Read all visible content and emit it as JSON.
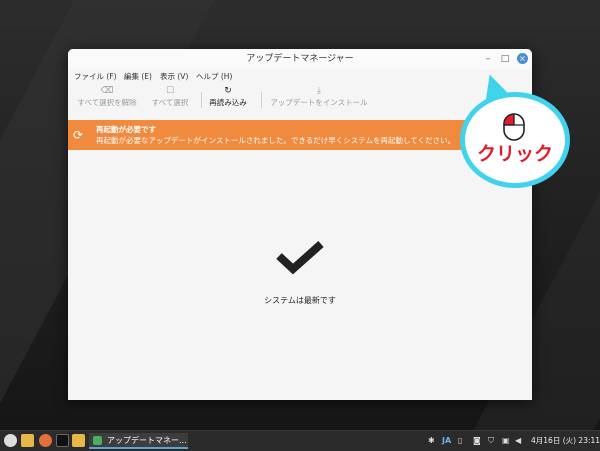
{
  "window": {
    "title": "アップデートマネージャー",
    "controls": {
      "minimize": "–",
      "maximize": "□",
      "close": "×"
    }
  },
  "menu": [
    "ファイル (F)",
    "編集 (E)",
    "表示 (V)",
    "ヘルプ (H)"
  ],
  "toolbar": {
    "clear_label": "すべて選択を解除",
    "clear_icon": "⌫",
    "select_all_label": "すべて選択",
    "select_all_icon": "☐",
    "refresh_label": "再読み込み",
    "refresh_icon": "↻",
    "install_label": "アップデートをインストール",
    "install_icon": "⤓"
  },
  "banner": {
    "icon": "⟳",
    "title": "再起動が必要です",
    "message": "再起動が必要なアップデートがインストールされました。できるだけ早くシステムを再起動してください。",
    "color": "#ef8a3f"
  },
  "status": {
    "icon": "checkmark-icon",
    "text": "システムは最新です"
  },
  "callout": {
    "label": "クリック",
    "border_color": "#3fd3ee",
    "text_color": "#e21d2b"
  },
  "taskbar": {
    "task_label": "アップデートマネー...",
    "input_method": "JA",
    "clock": "4月16日 (火) 23:11"
  }
}
